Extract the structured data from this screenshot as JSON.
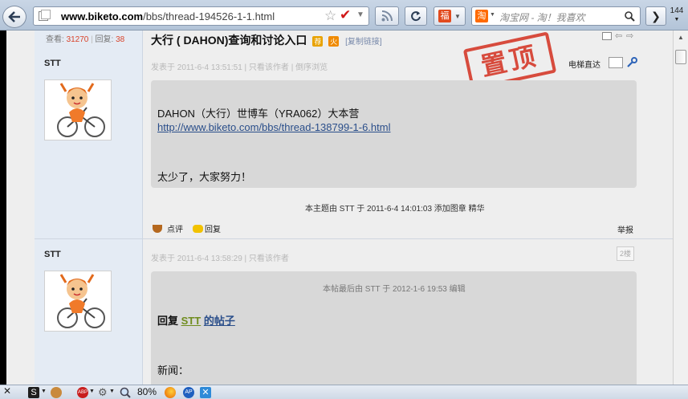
{
  "browser": {
    "url_domain": "www.biketo.com",
    "url_path": "/bbs/thread-194526-1-1.html",
    "search_placeholder": "淘宝网 - 淘！我喜欢",
    "tab_count": "144",
    "zoom": "80%"
  },
  "thread": {
    "views_label": "查看:",
    "views": "31270",
    "replies_label": "回复:",
    "replies": "38",
    "title": "大行 ( DAHON)查询和讨论入口",
    "copy_link": "[复制链接]",
    "stamp_text": "置顶",
    "floor_jump_label": "电梯直达"
  },
  "posts": [
    {
      "author": "STT",
      "meta": "发表于 2011-6-4 13:51:51 | 只看该作者 | 倒序浏览",
      "lines": [
        "DAHON（大行）世博车（YRA062）大本营",
        "http://www.biketo.com/bbs/thread-138799-1-6.html",
        "太少了，大家努力！"
      ],
      "note": "本主题由 STT 于 2011-6-4 14:01:03 添加图章 精华",
      "actions": [
        "点评",
        "回复"
      ],
      "report": "举报"
    },
    {
      "author": "STT",
      "meta": "发表于 2011-6-4 13:58:29 | 只看该作者",
      "floor": "2楼",
      "edit_note": "本帖最后由 STT 于 2012-1-6 19:53 编辑",
      "reply_prefix": "回复",
      "reply_user": "STT",
      "reply_suffix": "的帖子",
      "text": "新闻："
    }
  ]
}
